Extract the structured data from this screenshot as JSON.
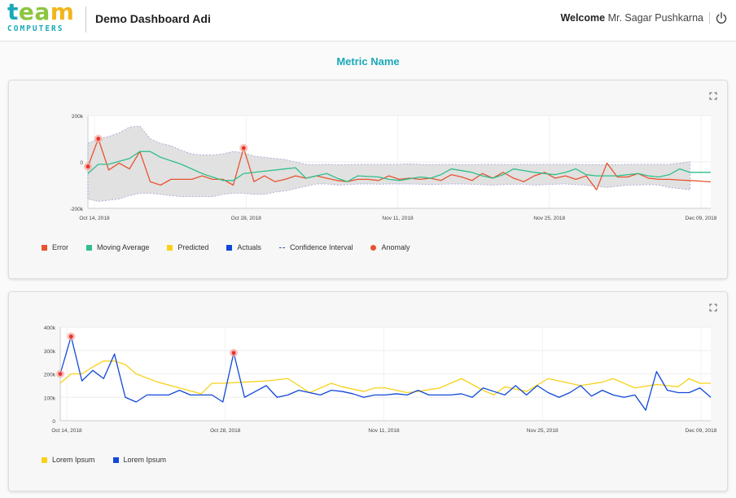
{
  "header": {
    "logo_word": "team",
    "logo_sub": "COMPUTERS",
    "app_title": "Demo Dashboard Adi",
    "welcome_label": "Welcome",
    "user_name": "Mr. Sagar Pushkarna"
  },
  "metric_title": "Metric Name",
  "colors": {
    "accent": "#1aa9b9",
    "logo_letters": [
      "#1aa9b9",
      "#8cc63f",
      "#8cc63f",
      "#f2b61a"
    ],
    "error": "#e8532f",
    "moving_average": "#2fbf8a",
    "predicted": "#f7d21a",
    "actuals": "#1048d8",
    "confidence": "#2a4ca8",
    "anomaly": "#e8532f"
  },
  "chart_data": [
    {
      "type": "line",
      "y_ticks": [
        "200k",
        "0",
        "-200k"
      ],
      "ylim": [
        -200000,
        200000
      ],
      "x_ticks": [
        "Oct 14, 2018",
        "Oct 28, 2018",
        "Nov 11, 2018",
        "Nov 25, 2018",
        "Dec 09, 2018"
      ],
      "xlim": [
        0,
        60
      ],
      "series": [
        {
          "name": "Error",
          "color": "#e8532f",
          "x": [
            0,
            1,
            2,
            3,
            4,
            5,
            6,
            7,
            8,
            9,
            10,
            11,
            12,
            13,
            14,
            15,
            16,
            17,
            18,
            19,
            20,
            21,
            22,
            23,
            24,
            25,
            26,
            27,
            28,
            29,
            30,
            31,
            32,
            33,
            34,
            35,
            36,
            37,
            38,
            39,
            40,
            41,
            42,
            43,
            44,
            45,
            46,
            47,
            48,
            49,
            50,
            51,
            52,
            53,
            54,
            55,
            56,
            57,
            58,
            59,
            60
          ],
          "y": [
            -20000,
            100000,
            -35000,
            -5000,
            -30000,
            45000,
            -85000,
            -100000,
            -75000,
            -75000,
            -75000,
            -60000,
            -75000,
            -75000,
            -100000,
            60000,
            -85000,
            -60000,
            -85000,
            -75000,
            -60000,
            -70000,
            -60000,
            -70000,
            -80000,
            -85000,
            -75000,
            -75000,
            -80000,
            -60000,
            -75000,
            -70000,
            -75000,
            -70000,
            -80000,
            -55000,
            -65000,
            -80000,
            -50000,
            -70000,
            -45000,
            -70000,
            -85000,
            -60000,
            -45000,
            -70000,
            -60000,
            -75000,
            -60000,
            -120000,
            -5000,
            -65000,
            -65000,
            -50000,
            -70000,
            -75000,
            -75000,
            -78000,
            -80000,
            -83000,
            -86000
          ]
        },
        {
          "name": "Moving Average",
          "color": "#2fbf8a",
          "x": [
            0,
            1,
            2,
            4,
            5,
            6,
            7,
            9,
            11,
            13,
            14,
            15,
            17,
            19,
            20,
            21,
            22,
            23,
            24,
            25,
            26,
            28,
            29,
            30,
            32,
            33,
            34,
            35,
            37,
            38,
            39,
            40,
            41,
            43,
            45,
            46,
            47,
            48,
            49,
            50,
            51,
            53,
            54,
            55,
            56,
            57,
            58,
            59,
            60
          ],
          "y": [
            -50000,
            -10000,
            -10000,
            15000,
            45000,
            45000,
            20000,
            -10000,
            -50000,
            -80000,
            -80000,
            -50000,
            -40000,
            -30000,
            -25000,
            -70000,
            -60000,
            -50000,
            -70000,
            -85000,
            -60000,
            -65000,
            -75000,
            -80000,
            -65000,
            -70000,
            -55000,
            -30000,
            -45000,
            -60000,
            -70000,
            -55000,
            -30000,
            -45000,
            -55000,
            -45000,
            -30000,
            -55000,
            -60000,
            -60000,
            -60000,
            -50000,
            -60000,
            -65000,
            -55000,
            -30000,
            -45000,
            -45000,
            -45000
          ]
        }
      ],
      "confidence_band": {
        "x": [
          0,
          1,
          2,
          3,
          4,
          5,
          6,
          7,
          8,
          9,
          10,
          11,
          12,
          13,
          14,
          15,
          16,
          17,
          18,
          19,
          20,
          21,
          22,
          23,
          24,
          25,
          26,
          27,
          28,
          29,
          30,
          31,
          32,
          33,
          34,
          35,
          36,
          37,
          38,
          39,
          40,
          41,
          42,
          43,
          44,
          45,
          46,
          47,
          48,
          49,
          50,
          51,
          52,
          53,
          54,
          55,
          56,
          57,
          58
        ],
        "upper": [
          80000,
          100000,
          110000,
          125000,
          150000,
          155000,
          100000,
          80000,
          70000,
          50000,
          35000,
          30000,
          30000,
          35000,
          45000,
          40000,
          25000,
          20000,
          15000,
          10000,
          0,
          -10000,
          -12000,
          -10000,
          -12000,
          -12000,
          -10000,
          -10000,
          -10000,
          -10000,
          -10000,
          -8000,
          -10000,
          -12000,
          -10000,
          -10000,
          -12000,
          -12000,
          -10000,
          -10000,
          -10000,
          -12000,
          -10000,
          -10000,
          -10000,
          -10000,
          -10000,
          -10000,
          -12000,
          -12000,
          -12000,
          -12000,
          -10000,
          -10000,
          -10000,
          -10000,
          -10000,
          -5000,
          0
        ],
        "lower": [
          -160000,
          -170000,
          -165000,
          -160000,
          -145000,
          -135000,
          -135000,
          -140000,
          -145000,
          -150000,
          -150000,
          -150000,
          -150000,
          -140000,
          -135000,
          -135000,
          -140000,
          -140000,
          -130000,
          -125000,
          -115000,
          -105000,
          -95000,
          -95000,
          -100000,
          -98000,
          -95000,
          -95000,
          -96000,
          -95000,
          -95000,
          -95000,
          -96000,
          -98000,
          -96000,
          -95000,
          -95000,
          -96000,
          -98000,
          -100000,
          -98000,
          -96000,
          -96000,
          -100000,
          -98000,
          -96000,
          -95000,
          -98000,
          -100000,
          -105000,
          -110000,
          -105000,
          -100000,
          -100000,
          -98000,
          -100000,
          -110000,
          -115000,
          -120000
        ]
      },
      "anomalies": [
        {
          "x": 0,
          "y": -20000
        },
        {
          "x": 1,
          "y": 100000
        },
        {
          "x": 15,
          "y": 60000
        }
      ],
      "legend": [
        {
          "label": "Error",
          "kind": "square",
          "color": "#e8532f"
        },
        {
          "label": "Moving Average",
          "kind": "square",
          "color": "#2fbf8a"
        },
        {
          "label": "Predicted",
          "kind": "square",
          "color": "#f7d21a"
        },
        {
          "label": "Actuals",
          "kind": "square",
          "color": "#1048d8"
        },
        {
          "label": "Confidence Interval",
          "kind": "dash",
          "color": "#2a4ca8"
        },
        {
          "label": "Anomaly",
          "kind": "dot",
          "color": "#e8532f"
        }
      ],
      "grid": true,
      "legend_placement": "bottom-left"
    },
    {
      "type": "line",
      "y_ticks": [
        "400k",
        "300k",
        "200k",
        "100k",
        "0"
      ],
      "ylim": [
        0,
        400000
      ],
      "x_ticks": [
        "Oct 14, 2018",
        "Oct 28, 2018",
        "Nov 11, 2018",
        "Nov 25, 2018",
        "Dec 09, 2018"
      ],
      "xlim": [
        0,
        60
      ],
      "series": [
        {
          "name": "Lorem Ipsum",
          "color": "#f7d21a",
          "x": [
            0,
            1,
            2,
            3,
            4,
            5,
            6,
            7,
            9,
            11,
            13,
            14,
            15,
            17,
            19,
            21,
            22,
            23,
            25,
            26,
            28,
            29,
            30,
            32,
            33,
            35,
            37,
            39,
            40,
            41,
            43,
            45,
            46,
            48,
            50,
            51,
            53,
            55,
            56,
            57,
            58,
            59,
            60
          ],
          "y": [
            160000,
            200000,
            200000,
            230000,
            255000,
            255000,
            240000,
            200000,
            165000,
            140000,
            115000,
            160000,
            160000,
            165000,
            170000,
            180000,
            150000,
            120000,
            160000,
            145000,
            125000,
            140000,
            140000,
            120000,
            125000,
            140000,
            180000,
            130000,
            110000,
            145000,
            125000,
            180000,
            170000,
            150000,
            165000,
            180000,
            140000,
            155000,
            150000,
            145000,
            180000,
            160000,
            160000
          ]
        },
        {
          "name": "Lorem Ipsum",
          "color": "#1048d8",
          "x": [
            0,
            1,
            2,
            3,
            4,
            5,
            6,
            7,
            8,
            9,
            10,
            11,
            12,
            13,
            14,
            15,
            16,
            17,
            18,
            19,
            20,
            21,
            22,
            23,
            24,
            25,
            26,
            27,
            28,
            29,
            30,
            31,
            32,
            33,
            34,
            35,
            36,
            37,
            38,
            39,
            40,
            41,
            42,
            43,
            44,
            45,
            46,
            47,
            48,
            49,
            50,
            51,
            52,
            53,
            54,
            55,
            56,
            57,
            58,
            59,
            60
          ],
          "y": [
            200000,
            360000,
            170000,
            215000,
            180000,
            285000,
            100000,
            80000,
            110000,
            110000,
            110000,
            130000,
            110000,
            110000,
            110000,
            80000,
            290000,
            100000,
            125000,
            150000,
            100000,
            110000,
            130000,
            120000,
            110000,
            130000,
            125000,
            115000,
            100000,
            110000,
            110000,
            115000,
            110000,
            130000,
            110000,
            110000,
            110000,
            115000,
            100000,
            140000,
            125000,
            110000,
            150000,
            110000,
            150000,
            120000,
            100000,
            120000,
            150000,
            105000,
            130000,
            110000,
            100000,
            110000,
            45000,
            210000,
            130000,
            120000,
            120000,
            140000,
            100000
          ]
        }
      ],
      "anomalies": [
        {
          "x": 0,
          "y": 200000
        },
        {
          "x": 1,
          "y": 360000
        },
        {
          "x": 16,
          "y": 290000
        }
      ],
      "legend": [
        {
          "label": "Lorem Ipsum",
          "kind": "square",
          "color": "#f7d21a"
        },
        {
          "label": "Lorem Ipsum",
          "kind": "square",
          "color": "#1048d8"
        }
      ],
      "grid": true,
      "legend_placement": "bottom-left"
    }
  ]
}
